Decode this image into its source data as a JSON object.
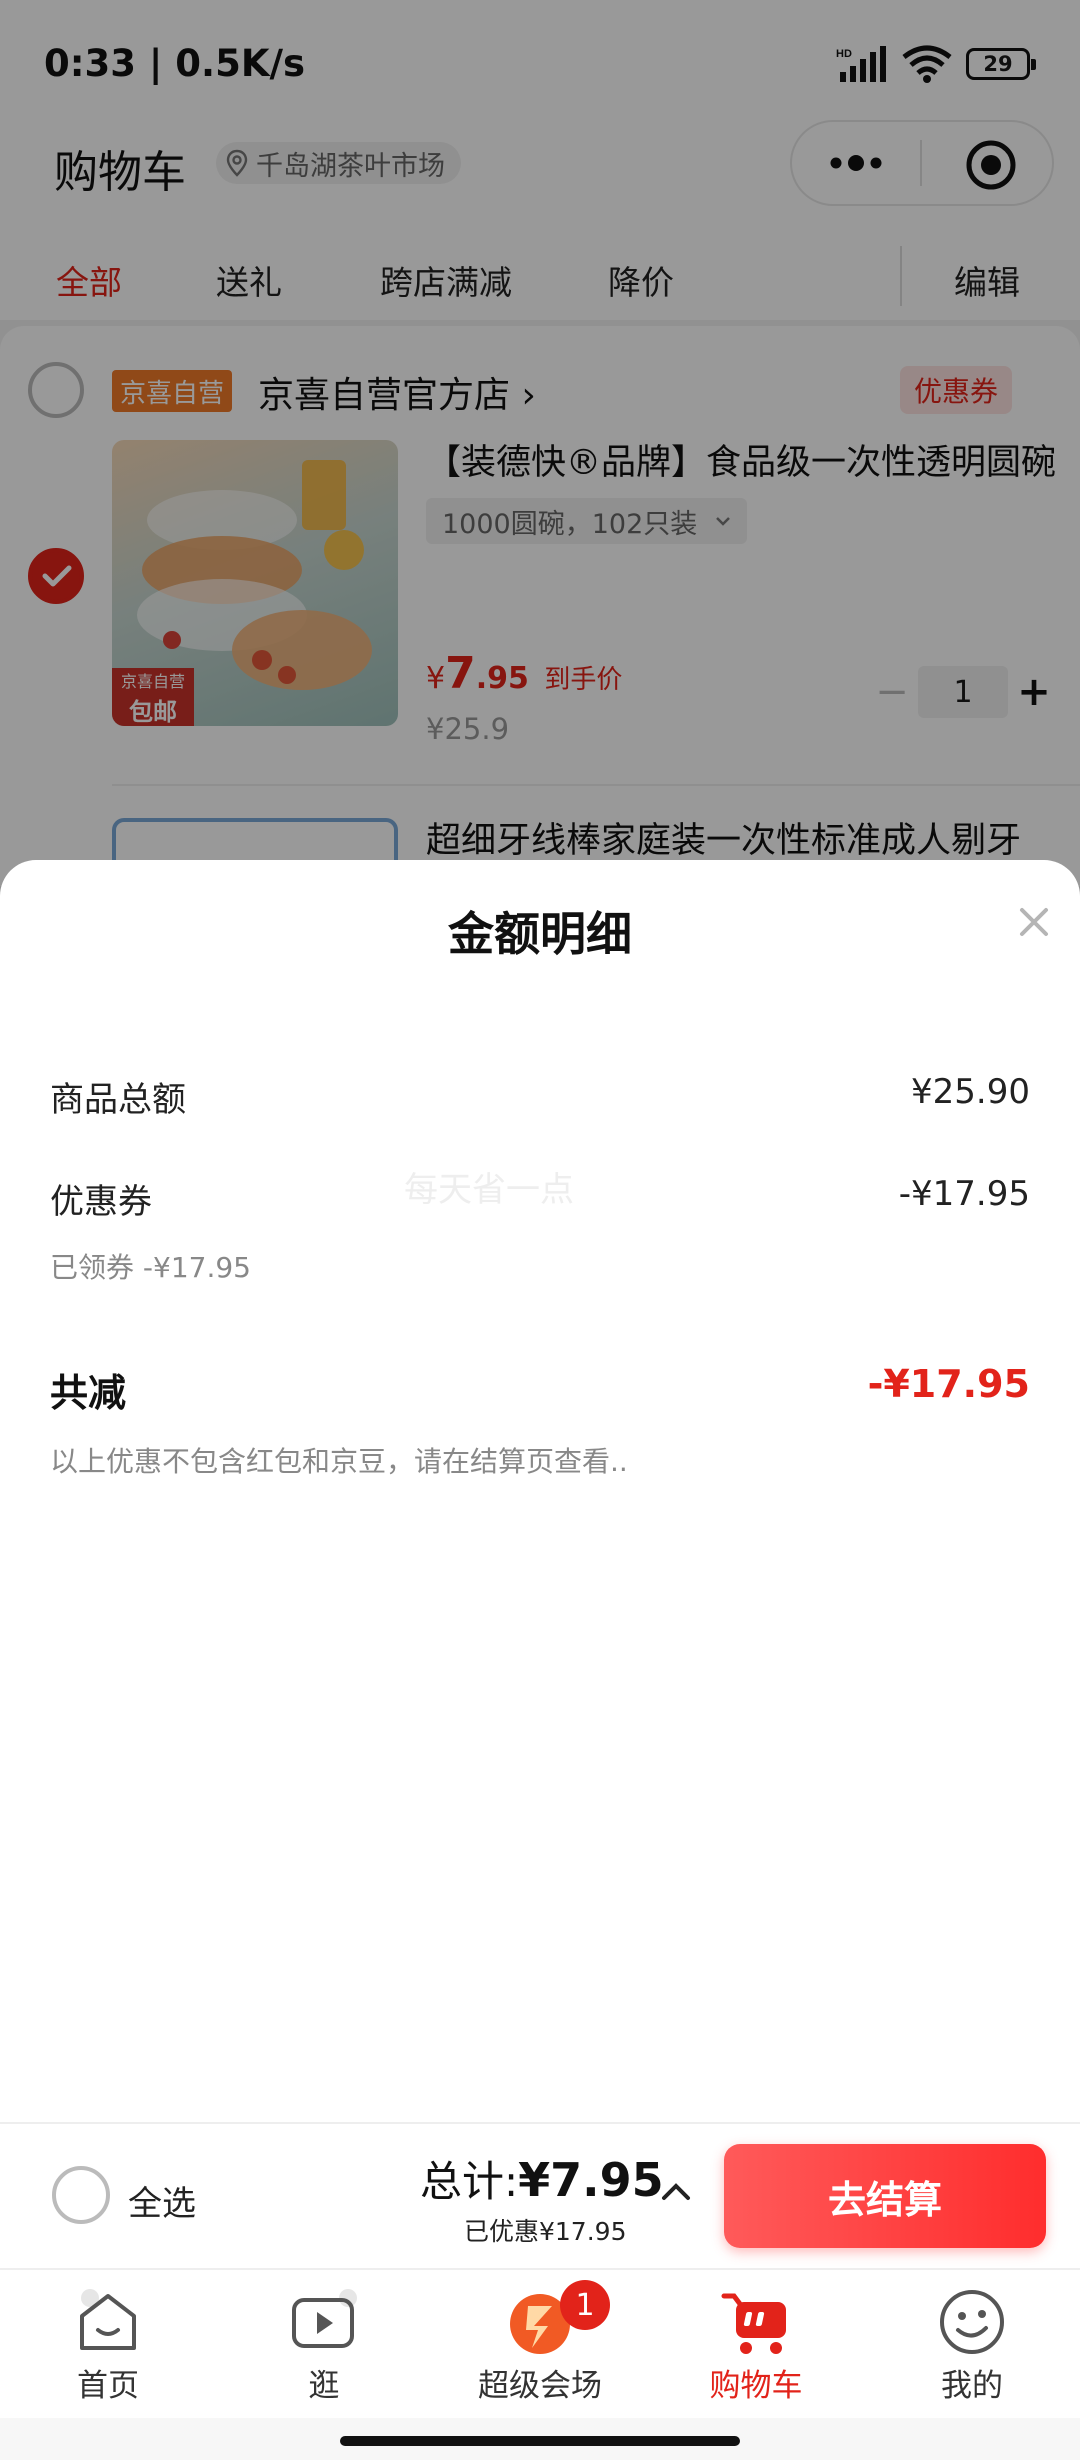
{
  "status_bar": {
    "time_speed": "0:33 | 0.5K/s",
    "battery": "29"
  },
  "header": {
    "title": "购物车",
    "location": "千岛湖茶叶市场"
  },
  "filter_tabs": {
    "all": "全部",
    "gift": "送礼",
    "cross_store": "跨店满减",
    "price_drop": "降价",
    "edit": "编辑"
  },
  "store": {
    "badge": "京喜自营",
    "name": "京喜自营官方店 ›",
    "coupon": "优惠券"
  },
  "product": {
    "image_tag_top": "京喜自营",
    "image_tag_bottom": "包邮",
    "title": "【装德快®品牌】食品级一次性透明圆碗",
    "spec": "1000圆碗，102只装",
    "price_symbol": "¥",
    "price_main": "7",
    "price_decimal": ".95",
    "price_note": "到手价",
    "original_price": "¥25.9",
    "quantity": "1"
  },
  "product2": {
    "title": "超细牙线棒家庭装一次性标准成人剔牙"
  },
  "sheet": {
    "title": "金额明细",
    "watermark": "每天省一点",
    "goods_total_label": "商品总额",
    "goods_total_value": "¥25.90",
    "coupon_label": "优惠券",
    "coupon_value": "-¥17.95",
    "coupon_sub": "已领券 -¥17.95",
    "total_reduce_label": "共减",
    "total_reduce_value": "-¥17.95",
    "note": "以上优惠不包含红包和京豆，请在结算页查看.."
  },
  "bottom_bar": {
    "select_all": "全选",
    "total_label": "总计:",
    "total_value": "¥7.95",
    "discount": "已优惠¥17.95",
    "checkout": "去结算"
  },
  "tab_bar": {
    "home": "首页",
    "browse": "逛",
    "venue": "超级会场",
    "venue_badge": "1",
    "cart": "购物车",
    "mine": "我的"
  },
  "colors": {
    "accent": "#e2231a",
    "checkout_gradient_start": "#ff5a5a",
    "store_badge": "#f07a28"
  },
  "icons": [
    "location-icon",
    "more-icon",
    "target-icon",
    "check-icon",
    "close-icon",
    "chevron-up-icon",
    "home-icon",
    "play-icon",
    "venue-icon",
    "cart-icon",
    "smile-icon",
    "signal-icon",
    "wifi-icon",
    "battery-icon"
  ]
}
